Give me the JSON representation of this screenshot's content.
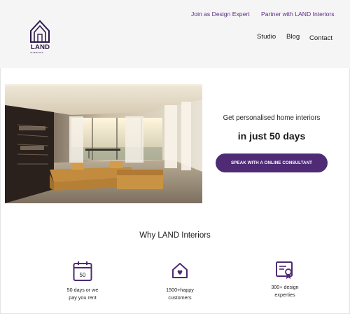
{
  "brand": {
    "logo_word": "LAND",
    "logo_subtext": "INTERIORS",
    "accent": "#4e2b74"
  },
  "header": {
    "top_links": [
      "Join as Design Expert",
      "Partner with LAND Interiors"
    ],
    "nav": [
      "Studio",
      "Blog",
      "Contact"
    ]
  },
  "hero": {
    "image": "living-room-photo",
    "tagline": "Get personalised home interiors",
    "headline": "in just 50 days",
    "cta_label": "SPEAK WITH A ONLINE CONSULTANT"
  },
  "why": {
    "title": "Why LAND Interiors",
    "features": [
      {
        "icon": "calendar-icon",
        "badge": "50",
        "label": "50 days or we\npay you rent"
      },
      {
        "icon": "home-heart-icon",
        "label": "1500+happy\ncustomers"
      },
      {
        "icon": "certificate-icon",
        "label": "300+ design\nexperties"
      }
    ]
  }
}
